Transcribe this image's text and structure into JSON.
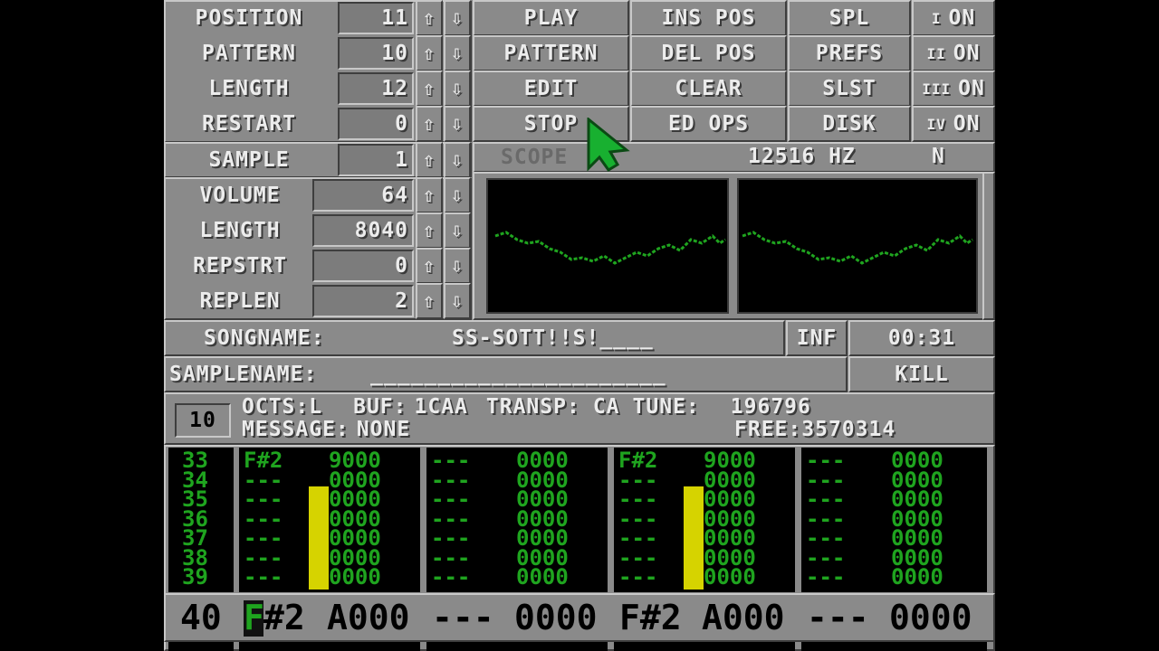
{
  "song_controls": [
    {
      "label": "POSITION",
      "value": "11"
    },
    {
      "label": "PATTERN",
      "value": "10"
    },
    {
      "label": "LENGTH",
      "value": "12"
    },
    {
      "label": "RESTART",
      "value": "0"
    }
  ],
  "sample_control": {
    "label": "SAMPLE",
    "value": "1"
  },
  "sample_params": [
    {
      "label": "VOLUME",
      "value": "64"
    },
    {
      "label": "LENGTH",
      "value": "8040"
    },
    {
      "label": "REPSTRT",
      "value": "0"
    },
    {
      "label": "REPLEN",
      "value": "2"
    }
  ],
  "arrows": {
    "up": "⇧",
    "down": "⇩"
  },
  "menu_buttons": [
    [
      "PLAY",
      "INS POS",
      "SPL"
    ],
    [
      "PATTERN",
      "DEL POS",
      "PREFS"
    ],
    [
      "EDIT",
      "CLEAR",
      "SLST"
    ],
    [
      "STOP",
      "ED OPS",
      "DISK"
    ]
  ],
  "channel_toggles": [
    {
      "num": "I",
      "state": "ON"
    },
    {
      "num": "II",
      "state": "ON"
    },
    {
      "num": "III",
      "state": "ON"
    },
    {
      "num": "IV",
      "state": "ON"
    }
  ],
  "scope": {
    "label": "SCOPE",
    "freq": "12516 HZ",
    "mode": "N"
  },
  "songname": {
    "label": "SONGNAME:",
    "value": "SS-SOTT!!S!____",
    "inf": "INF",
    "time": "00:31"
  },
  "samplename": {
    "label": "SAMPLENAME:",
    "value": "______________________",
    "kill": "KILL"
  },
  "status": {
    "pattern": "10",
    "octs_label": "OCTS:",
    "octs": "L",
    "buf_label": "BUF:",
    "buf": "1CAA",
    "transp_label": "TRANSP:",
    "transp": "CA",
    "tune_label": "TUNE:",
    "tune": "196796",
    "message_label": "MESSAGE:",
    "message": "NONE",
    "free_label": "FREE:",
    "free": "3570314"
  },
  "tracker": {
    "row_numbers": [
      "33",
      "34",
      "35",
      "36",
      "37",
      "38",
      "39"
    ],
    "channels": [
      [
        [
          "F#2",
          "9000"
        ],
        [
          "---",
          "0000"
        ],
        [
          "---",
          "0000"
        ],
        [
          "---",
          "0000"
        ],
        [
          "---",
          "0000"
        ],
        [
          "---",
          "0000"
        ],
        [
          "---",
          "0000"
        ]
      ],
      [
        [
          "---",
          "0000"
        ],
        [
          "---",
          "0000"
        ],
        [
          "---",
          "0000"
        ],
        [
          "---",
          "0000"
        ],
        [
          "---",
          "0000"
        ],
        [
          "---",
          "0000"
        ],
        [
          "---",
          "0000"
        ]
      ],
      [
        [
          "F#2",
          "9000"
        ],
        [
          "---",
          "0000"
        ],
        [
          "---",
          "0000"
        ],
        [
          "---",
          "0000"
        ],
        [
          "---",
          "0000"
        ],
        [
          "---",
          "0000"
        ],
        [
          "---",
          "0000"
        ]
      ],
      [
        [
          "---",
          "0000"
        ],
        [
          "---",
          "0000"
        ],
        [
          "---",
          "0000"
        ],
        [
          "---",
          "0000"
        ],
        [
          "---",
          "0000"
        ],
        [
          "---",
          "0000"
        ],
        [
          "---",
          "0000"
        ]
      ]
    ],
    "current_row": {
      "num": "40",
      "cursor_char": "F",
      "cells": [
        [
          "#2",
          "A000"
        ],
        [
          "---",
          "0000"
        ],
        [
          "F#2",
          "A000"
        ],
        [
          "---",
          "0000"
        ]
      ]
    }
  },
  "colors": {
    "panel": "#888888",
    "track_green": "#1fa41f",
    "vu_yellow": "#d6d300",
    "pointer": "#18b030"
  }
}
